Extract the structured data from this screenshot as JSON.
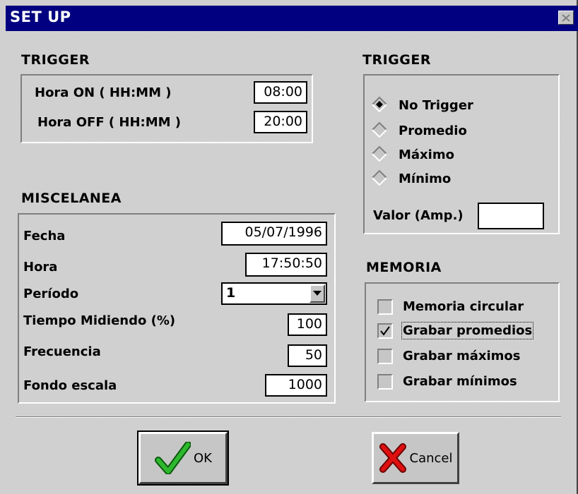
{
  "window": {
    "title": "SET UP",
    "close_icon": "close-icon"
  },
  "trigger_time": {
    "title": "TRIGGER",
    "hora_on_label": "Hora ON ( HH:MM )",
    "hora_on_value": "08:00",
    "hora_off_label": "Hora OFF ( HH:MM )",
    "hora_off_value": "20:00"
  },
  "trigger_mode": {
    "title": "TRIGGER",
    "options": [
      {
        "label": "No Trigger",
        "selected": true
      },
      {
        "label": "Promedio",
        "selected": false
      },
      {
        "label": "Máximo",
        "selected": false
      },
      {
        "label": "Mínimo",
        "selected": false
      }
    ],
    "valor_label": "Valor (Amp.)",
    "valor_value": ""
  },
  "miscelanea": {
    "title": "MISCELANEA",
    "fecha_label": "Fecha",
    "fecha_value": "05/07/1996",
    "hora_label": "Hora",
    "hora_value": "17:50:50",
    "periodo_label": "Período",
    "periodo_value": "1",
    "tiempo_label": "Tiempo Midiendo (%)",
    "tiempo_value": "100",
    "frecuencia_label": "Frecuencia",
    "frecuencia_value": "50",
    "fondo_label": "Fondo escala",
    "fondo_value": "1000"
  },
  "memoria": {
    "title": "MEMORIA",
    "options": [
      {
        "label": "Memoria circular",
        "checked": false
      },
      {
        "label": "Grabar promedios",
        "checked": true
      },
      {
        "label": "Grabar máximos",
        "checked": false
      },
      {
        "label": "Grabar mínimos",
        "checked": false
      }
    ]
  },
  "buttons": {
    "ok_label": "OK",
    "cancel_label": "Cancel",
    "ok_icon": "green-checkmark-icon",
    "cancel_icon": "red-x-icon"
  },
  "colors": {
    "titlebar": "#000080",
    "dialog_bg": "#c6c6c6",
    "ok_check": "#1f9a1f",
    "cancel_x": "#cc0000"
  }
}
